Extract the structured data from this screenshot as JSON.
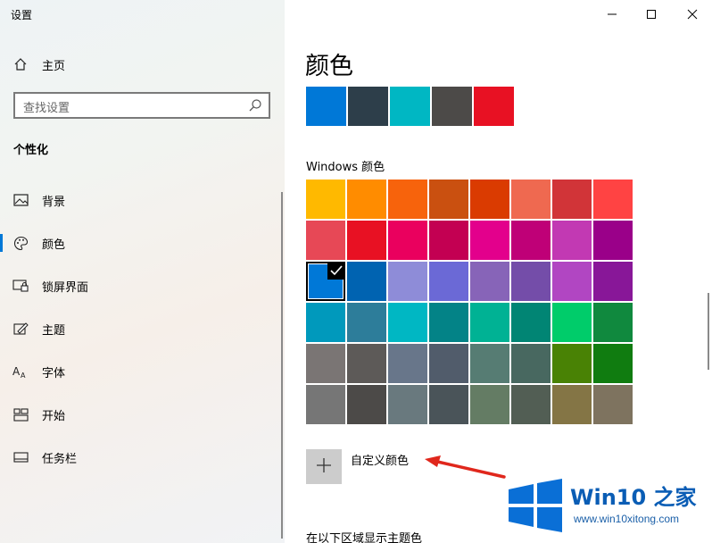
{
  "window": {
    "title": "设置",
    "controls": [
      "minimize-icon",
      "maximize-icon",
      "close-icon"
    ]
  },
  "sidebar": {
    "home_label": "主页",
    "search_placeholder": "查找设置",
    "section_title": "个性化",
    "items": [
      {
        "label": "背景",
        "icon": "picture-icon",
        "active": false
      },
      {
        "label": "颜色",
        "icon": "palette-icon",
        "active": true
      },
      {
        "label": "锁屏界面",
        "icon": "lock-screen-icon",
        "active": false
      },
      {
        "label": "主题",
        "icon": "theme-icon",
        "active": false
      },
      {
        "label": "字体",
        "icon": "font-icon",
        "active": false
      },
      {
        "label": "开始",
        "icon": "start-icon",
        "active": false
      },
      {
        "label": "任务栏",
        "icon": "taskbar-icon",
        "active": false
      }
    ]
  },
  "main": {
    "title": "颜色",
    "recent_colors": [
      "#0078d7",
      "#2d3e4a",
      "#00b7c3",
      "#4c4a48",
      "#e81123"
    ],
    "windows_colors_label": "Windows 颜色",
    "windows_colors": [
      [
        "#ffb900",
        "#ff8c00",
        "#f7630c",
        "#ca5010",
        "#da3b01",
        "#ef6950",
        "#d13438",
        "#ff4343"
      ],
      [
        "#e74856",
        "#e81123",
        "#ea005e",
        "#c30052",
        "#e3008c",
        "#bf0077",
        "#c239b3",
        "#9a0089"
      ],
      [
        "#0078d7",
        "#0063b1",
        "#8e8cd8",
        "#6b69d6",
        "#8764b8",
        "#744da9",
        "#b146c2",
        "#881798"
      ],
      [
        "#0099bc",
        "#2d7d9a",
        "#00b7c3",
        "#038387",
        "#00b294",
        "#018574",
        "#00cc6a",
        "#10893e"
      ],
      [
        "#7a7574",
        "#5d5a58",
        "#68768a",
        "#515c6b",
        "#567c73",
        "#486860",
        "#498205",
        "#107c10"
      ],
      [
        "#767676",
        "#4c4a48",
        "#69797e",
        "#4a5459",
        "#647c64",
        "#525e54",
        "#847545",
        "#7e735f"
      ]
    ],
    "selected_color": "#0078d7",
    "custom_color_label": "自定义颜色",
    "accent_surfaces_label": "在以下区域显示主题色"
  },
  "watermark": {
    "brand": "Win10 之家",
    "url": "www.win10xitong.com",
    "logo_color": "#0a6fd6"
  }
}
